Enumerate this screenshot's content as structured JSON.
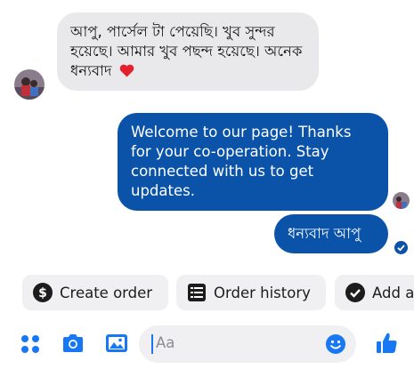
{
  "messages": {
    "incoming_text": "আপু, পার্সেল টা পেয়েছি। খুব সুন্দর হয়েছে। আমার খুব পছন্দ হয়েছে। অনেক ধন্যবাদ",
    "incoming_emoji": "heart-emoji",
    "outgoing_text": "Welcome to our page! Thanks for your co-operation. Stay connected with us to get updates.",
    "outgoing_reply": "ধন্যবাদ আপু"
  },
  "quick_actions": {
    "create_order": "Create order",
    "order_history": "Order history",
    "add_partial": "Add a"
  },
  "composer": {
    "placeholder": "Aa"
  },
  "icons": [
    "apps-grid-icon",
    "camera-icon",
    "image-icon",
    "emoji-icon",
    "like-icon",
    "dollar-icon",
    "list-icon",
    "check-circle-icon"
  ],
  "colors": {
    "accent": "#0a53a8",
    "incoming_bubble": "#e9e9eb",
    "toolbar_blue": "#1877f2",
    "chip_bg": "#f0f0f2"
  }
}
